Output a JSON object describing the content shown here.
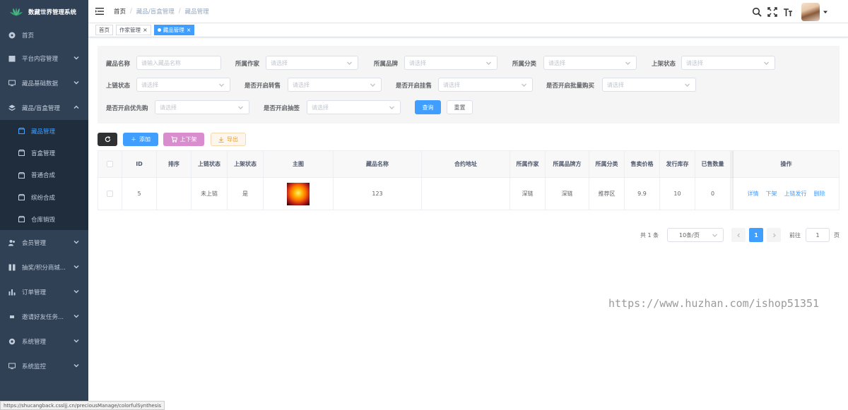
{
  "app": {
    "title": "数藏世界管理系统"
  },
  "sidebar": {
    "items": [
      {
        "label": "首页",
        "icon": "dashboard-icon",
        "has_children": false
      },
      {
        "label": "平台内容管理",
        "icon": "calendar-icon",
        "has_children": true
      },
      {
        "label": "藏品基础数据",
        "icon": "monitor-icon",
        "has_children": true
      },
      {
        "label": "藏品/盲盒管理",
        "icon": "layers-icon",
        "has_children": true,
        "expanded": true
      }
    ],
    "sub_items": [
      {
        "label": "藏品管理",
        "active": true
      },
      {
        "label": "盲盒管理",
        "active": false
      },
      {
        "label": "普通合成",
        "active": false
      },
      {
        "label": "缤纷合成",
        "active": false
      },
      {
        "label": "仓库销毁",
        "active": false
      }
    ],
    "bottom_items": [
      {
        "label": "会员管理",
        "icon": "users-icon"
      },
      {
        "label": "抽奖/积分商城...",
        "icon": "gift-icon"
      },
      {
        "label": "订单管理",
        "icon": "chart-icon"
      },
      {
        "label": "邀请好友任务...",
        "icon": "list-icon"
      },
      {
        "label": "系统管理",
        "icon": "gear-icon"
      },
      {
        "label": "系统监控",
        "icon": "monitor-icon"
      }
    ]
  },
  "navbar": {
    "breadcrumb": [
      "首页",
      "藏品/盲盒管理",
      "藏品管理"
    ]
  },
  "tags": [
    {
      "label": "首页",
      "closable": false,
      "active": false
    },
    {
      "label": "作家管理",
      "closable": true,
      "active": false
    },
    {
      "label": "藏品管理",
      "closable": true,
      "active": true
    }
  ],
  "filters": {
    "name_label": "藏品名称",
    "name_placeholder": "请输入藏品名称",
    "author_label": "所属作家",
    "brand_label": "所属品牌",
    "category_label": "所属分类",
    "shelf_label": "上架状态",
    "chain_label": "上链状态",
    "resale_label": "是否开启转售",
    "listing_label": "是否开启挂售",
    "bulk_label": "是否开启批量购买",
    "priority_label": "是否开启优先购",
    "lottery_label": "是否开启抽签",
    "select_placeholder": "请选择",
    "query_button": "查询",
    "reset_button": "重置"
  },
  "toolbar": {
    "add_label": "添加",
    "shelf_label": "上下架",
    "export_label": "导出"
  },
  "table": {
    "headers": [
      "ID",
      "排序",
      "上链状态",
      "上架状态",
      "主图",
      "藏品名称",
      "合约地址",
      "所属作家",
      "所属品牌方",
      "所属分类",
      "售卖价格",
      "发行库存",
      "已售数量",
      "操作"
    ],
    "rows": [
      {
        "id": "5",
        "sort": "",
        "chain_status": "未上链",
        "shelf_status": "是",
        "name": "123",
        "contract": "",
        "author": "深链",
        "brand": "深链",
        "category": "推荐区",
        "price": "9.9",
        "stock": "10",
        "sold": "0",
        "actions": [
          "详情",
          "下架",
          "上链发行",
          "删除"
        ]
      }
    ]
  },
  "pagination": {
    "total_text": "共 1 条",
    "page_size": "10条/页",
    "current_page": "1",
    "goto_label": "前往",
    "goto_value": "1",
    "page_suffix": "页"
  },
  "watermark": "https://www.huzhan.com/ishop51351",
  "status_url": "https://shucangback.cssljj.cn/preciousManage/colorfulSynthesis"
}
